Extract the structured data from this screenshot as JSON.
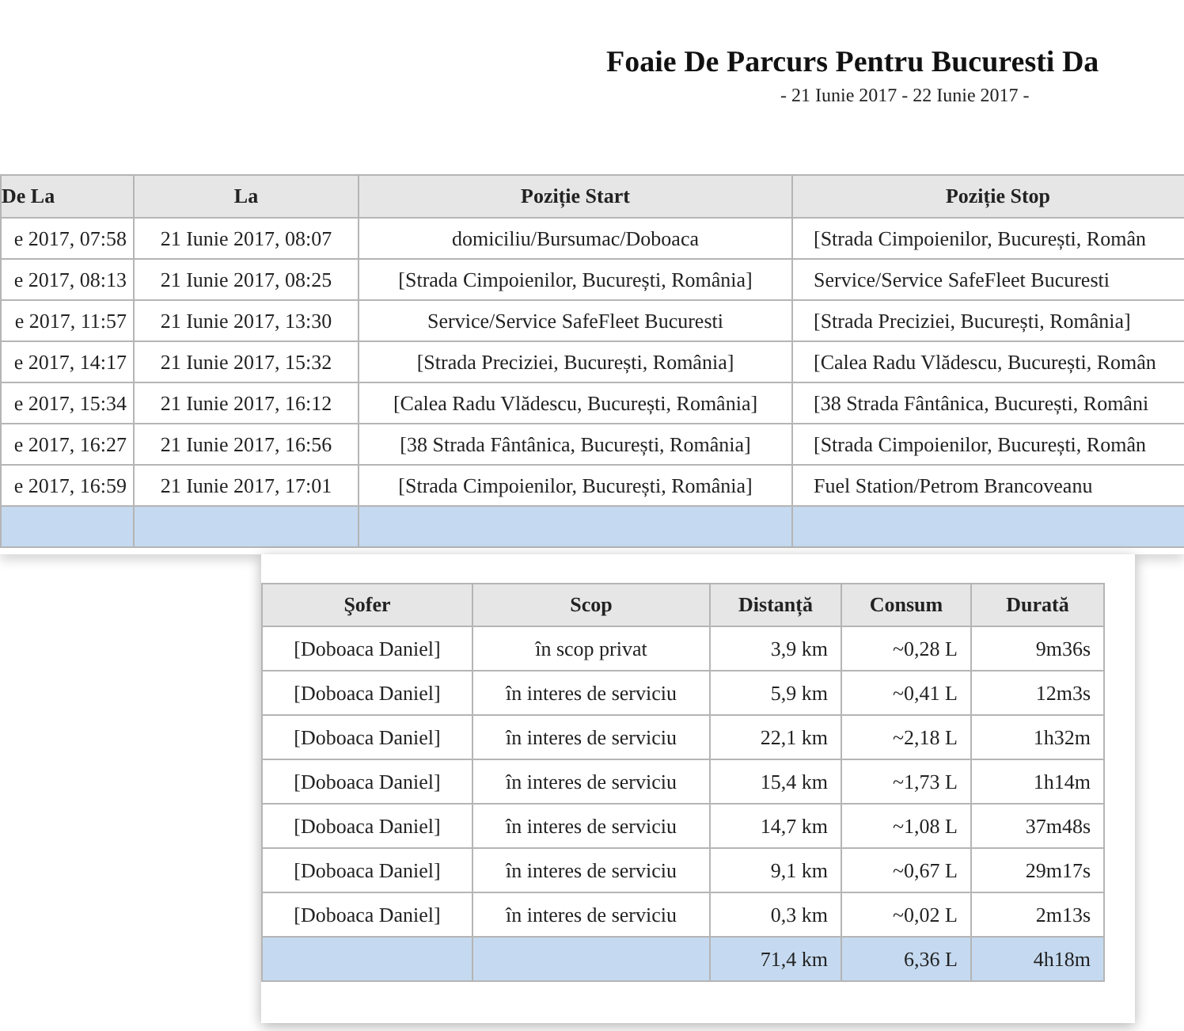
{
  "report": {
    "title": "Foaie De Parcurs Pentru Bucuresti Da",
    "subtitle": "- 21 Iunie 2017 - 22 Iunie 2017 -"
  },
  "trips_table": {
    "columns": [
      "De La",
      "La",
      "Poziție Start",
      "Poziție Stop"
    ],
    "rows": [
      [
        "e 2017, 07:58",
        "21 Iunie 2017, 08:07",
        "domiciliu/Bursumac/Doboaca",
        "[Strada Cimpoienilor, București, Român"
      ],
      [
        "e 2017, 08:13",
        "21 Iunie 2017, 08:25",
        "[Strada Cimpoienilor, București, România]",
        "Service/Service SafeFleet Bucuresti"
      ],
      [
        "e 2017, 11:57",
        "21 Iunie 2017, 13:30",
        "Service/Service SafeFleet Bucuresti",
        "[Strada Preciziei, București, România]"
      ],
      [
        "e 2017, 14:17",
        "21 Iunie 2017, 15:32",
        "[Strada Preciziei, București, România]",
        "[Calea Radu Vlădescu, București, Român"
      ],
      [
        "e 2017, 15:34",
        "21 Iunie 2017, 16:12",
        "[Calea Radu Vlădescu, București, România]",
        "[38 Strada Fântânica, București, Români"
      ],
      [
        "e 2017, 16:27",
        "21 Iunie 2017, 16:56",
        "[38 Strada Fântânica, București, România]",
        "[Strada Cimpoienilor, București, Român"
      ],
      [
        "e 2017, 16:59",
        "21 Iunie 2017, 17:01",
        "[Strada Cimpoienilor, București, România]",
        "Fuel Station/Petrom Brancoveanu"
      ]
    ]
  },
  "summary_table": {
    "columns": [
      "Şofer",
      "Scop",
      "Distanță",
      "Consum",
      "Durată"
    ],
    "rows": [
      [
        "[Doboaca Daniel]",
        "în scop privat",
        "3,9 km",
        "~0,28 L",
        "9m36s"
      ],
      [
        "[Doboaca Daniel]",
        "în interes de serviciu",
        "5,9 km",
        "~0,41 L",
        "12m3s"
      ],
      [
        "[Doboaca Daniel]",
        "în interes de serviciu",
        "22,1 km",
        "~2,18 L",
        "1h32m"
      ],
      [
        "[Doboaca Daniel]",
        "în interes de serviciu",
        "15,4 km",
        "~1,73 L",
        "1h14m"
      ],
      [
        "[Doboaca Daniel]",
        "în interes de serviciu",
        "14,7 km",
        "~1,08 L",
        "37m48s"
      ],
      [
        "[Doboaca Daniel]",
        "în interes de serviciu",
        "9,1 km",
        "~0,67 L",
        "29m17s"
      ],
      [
        "[Doboaca Daniel]",
        "în interes de serviciu",
        "0,3 km",
        "~0,02 L",
        "2m13s"
      ]
    ],
    "total": {
      "distance": "71,4 km",
      "consumption": "6,36 L",
      "duration": "4h18m"
    }
  }
}
